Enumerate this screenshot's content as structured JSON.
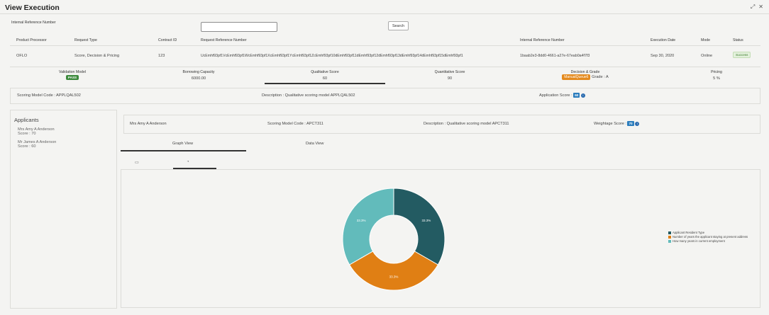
{
  "window": {
    "title": "View Execution",
    "expand_icon": "expand-icon",
    "close_icon": "close-icon"
  },
  "search": {
    "label": "Internal Reference Number",
    "value": "",
    "button_label": "Search"
  },
  "table": {
    "headers": [
      "Product Processor",
      "Request Type",
      "Contract ID",
      "Request Reference Number",
      "Internal Reference Number",
      "Execution Date",
      "Mode",
      "Status"
    ],
    "row": {
      "product_processor": "OFLO",
      "request_type": "Score, Decision & Pricing",
      "contract_id": "123",
      "request_reference_number": "UcEmhf93pf1VcEmhf93pf1WcEmhf93pf1XcEmhf93pf1YcEmhf93pf1ZcEmhf93pf10dEmhf93pf11dEmhf93pf12dEmhf93pf13dEmhf93pf14dEmhf93pf15dEmhf93pf1",
      "internal_reference_number": "1baab2e3-8dd0-4661-a27e-67eab0a4f7f3",
      "execution_date": "Sep 30, 2020",
      "mode": "Online",
      "status": "Success"
    }
  },
  "summary": {
    "validation_model": {
      "label": "Validation Model",
      "value": "PASS"
    },
    "borrowing_capacity": {
      "label": "Borrowing Capacity",
      "value": "6000.00"
    },
    "qualitative_score": {
      "label": "Qualitative Score",
      "value": "60"
    },
    "quantitative_score": {
      "label": "Quantitative Score",
      "value": "90"
    },
    "decision_grade": {
      "label": "Decision & Grade",
      "decision": "ManualQueue6",
      "grade": "Grade : A"
    },
    "pricing": {
      "label": "Pricing",
      "value": "5 %"
    }
  },
  "model_info": {
    "scoring_model_code": "Scoring Model Code : APPLQAL502",
    "description": "Description : Qualitative scoring model APPLQAL502",
    "application_score_label": "Application Score :",
    "application_score": "60"
  },
  "applicants": {
    "heading": "Applicants",
    "items": [
      {
        "name": "Mrs Amy A Anderson",
        "score": "Score : 70"
      },
      {
        "name": "Mr James A Anderson",
        "score": "Score : 60"
      }
    ]
  },
  "applicant_detail": {
    "name": "Mrs Amy A Anderson",
    "scoring_model_code": "Scoring Model Code : APCT311",
    "description": "Description : Qualitative scoring model APCT311",
    "weightage_score_label": "Weightage Score :",
    "weightage_score": "70"
  },
  "view_tabs": {
    "graph": "Graph View",
    "data": "Data View",
    "active": "graph"
  },
  "chart_tabs": {
    "bar_icon": "bar-chart-icon",
    "pie_icon": "pie-chart-icon",
    "active": "pie"
  },
  "chart_data": {
    "type": "pie",
    "variant": "donut",
    "categories": [
      "Applicant Resident Type",
      "Number of years the applicant staying at present address",
      "How many years in current employment"
    ],
    "values": [
      33.3,
      33.3,
      33.3
    ],
    "labels": [
      "33.3%",
      "33.3%",
      "33.3%"
    ],
    "colors": [
      "#235b62",
      "#e07f14",
      "#62bbbb"
    ],
    "legend_position": "right"
  }
}
